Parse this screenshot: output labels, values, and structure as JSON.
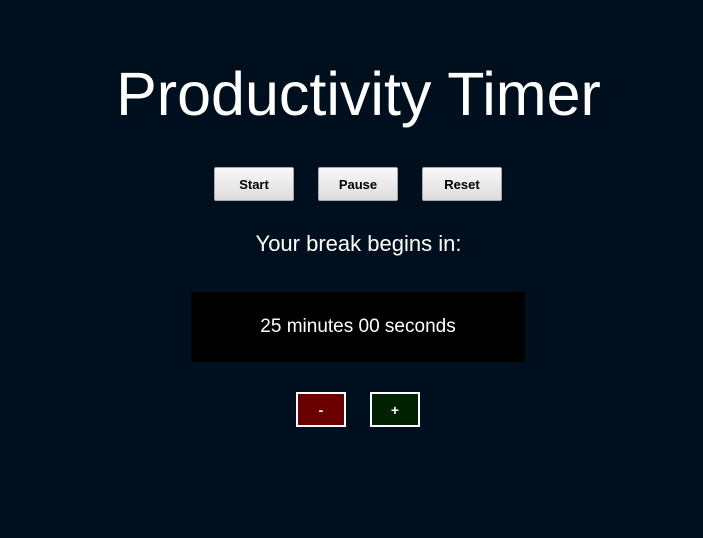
{
  "app": {
    "title": "Productivity Timer"
  },
  "controls": {
    "start_label": "Start",
    "pause_label": "Pause",
    "reset_label": "Reset"
  },
  "status": {
    "message": "Your break begins in:",
    "time_display": "25 minutes 00 seconds"
  },
  "adjust": {
    "decrease_label": "-",
    "increase_label": "+",
    "decrease_color": "#6b0000",
    "increase_color": "#002200"
  },
  "colors": {
    "background": "#000f1e",
    "display_background": "#000000",
    "text": "#ffffff"
  }
}
